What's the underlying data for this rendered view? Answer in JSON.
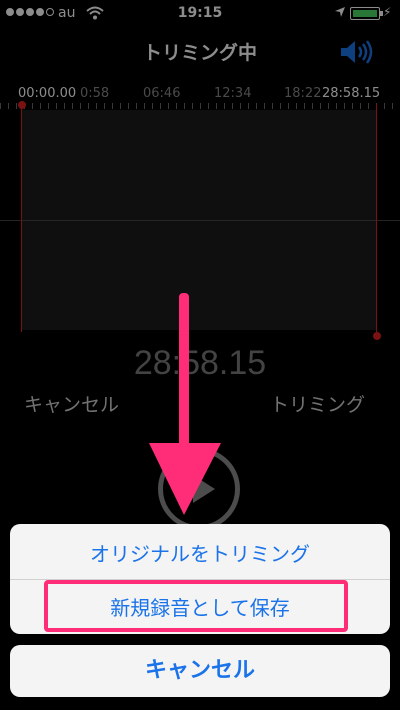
{
  "status_bar": {
    "carrier": "au",
    "time": "19:15",
    "signal_dots": [
      true,
      true,
      false,
      false,
      false
    ],
    "battery_color": "#4cd964"
  },
  "header": {
    "title": "トリミング中",
    "speaker_icon": "speaker-icon"
  },
  "timeline": {
    "start": "00:00.00",
    "marks": [
      "0:58",
      "06:46",
      "12:34",
      "18:22"
    ],
    "end": "28:58.15"
  },
  "duration": "28:58.15",
  "controls": {
    "cancel_label": "キャンセル",
    "trim_label": "トリミング",
    "play_icon": "play-icon"
  },
  "action_sheet": {
    "option_trim_original": "オリジナルをトリミング",
    "option_save_new": "新規録音として保存",
    "cancel": "キャンセル"
  },
  "colors": {
    "accent": "#1a73e8",
    "trim_handle": "#e02020",
    "annotation": "#ff2d78"
  }
}
